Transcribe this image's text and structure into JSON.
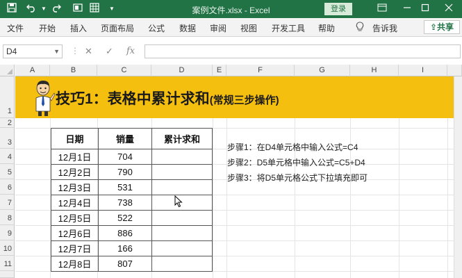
{
  "titlebar": {
    "title": "案例文件.xlsx  -  Excel",
    "login_label": "登录",
    "save_icon": "save-icon",
    "undo_icon": "undo-icon"
  },
  "ribbon": {
    "tabs": [
      "文件",
      "开始",
      "插入",
      "页面布局",
      "公式",
      "数据",
      "审阅",
      "视图",
      "开发工具",
      "帮助"
    ],
    "tell_me": "告诉我",
    "share_label": "共享"
  },
  "formula_bar": {
    "name_box": "D4",
    "formula": ""
  },
  "columns": [
    "A",
    "B",
    "C",
    "D",
    "E",
    "F",
    "G",
    "H",
    "I"
  ],
  "rows": [
    "1",
    "2",
    "3",
    "4",
    "5",
    "6",
    "7",
    "8",
    "9",
    "10",
    "11"
  ],
  "banner": {
    "title": "技巧1：表格中累计求和",
    "subtitle": "(常规三步操作)"
  },
  "table": {
    "headers": [
      "日期",
      "销量",
      "累计求和"
    ],
    "rows": [
      [
        "12月1日",
        "704",
        ""
      ],
      [
        "12月2日",
        "790",
        ""
      ],
      [
        "12月3日",
        "531",
        ""
      ],
      [
        "12月4日",
        "738",
        ""
      ],
      [
        "12月5日",
        "522",
        ""
      ],
      [
        "12月6日",
        "886",
        ""
      ],
      [
        "12月7日",
        "166",
        ""
      ],
      [
        "12月8日",
        "807",
        ""
      ]
    ]
  },
  "steps": [
    "步骤1：在D4单元格中输入公式=C4",
    "步骤2：D5单元格中输入公式=C5+D4",
    "步骤3：将D5单元格公式下拉填充即可"
  ],
  "colors": {
    "excel_green": "#217346",
    "banner_yellow": "#f5bf0f"
  }
}
